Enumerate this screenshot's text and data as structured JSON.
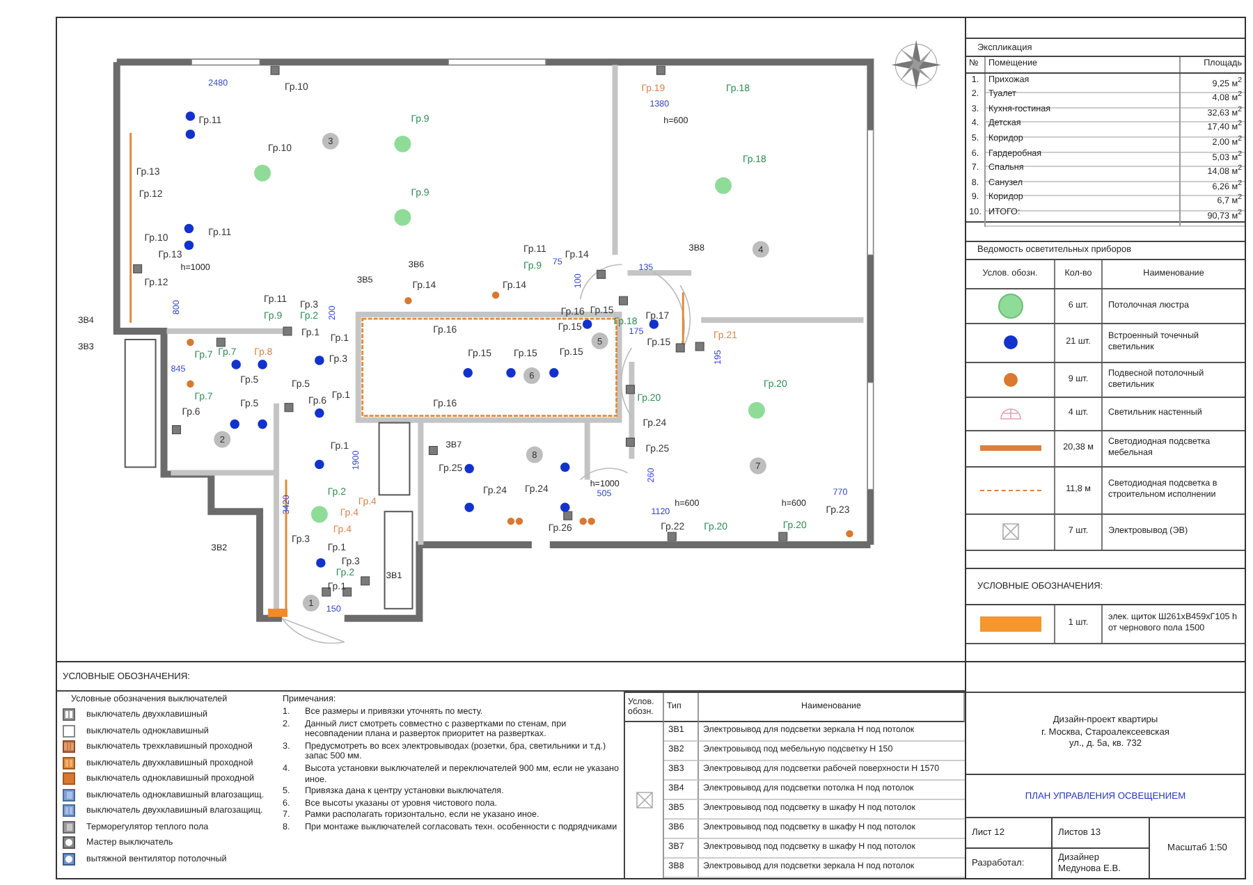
{
  "plan": {
    "labels": [
      {
        "text": "2480",
        "kind": "dimension"
      },
      {
        "text": "Гр.10",
        "kind": "group",
        "color": "#333333"
      },
      {
        "text": "Гр.11",
        "kind": "group",
        "color": "#333333"
      },
      {
        "text": "3",
        "kind": "room"
      },
      {
        "text": "Гр.10",
        "kind": "group",
        "color": "#333333"
      },
      {
        "text": "Гр.9",
        "kind": "group",
        "color": "#2f8a55"
      },
      {
        "text": "Гр.13",
        "kind": "group",
        "color": "#333333"
      },
      {
        "text": "Гр.12",
        "kind": "group",
        "color": "#333333"
      },
      {
        "text": "Гр.9",
        "kind": "group",
        "color": "#2f8a55"
      },
      {
        "text": "Гр.11",
        "kind": "group",
        "color": "#333333"
      },
      {
        "text": "Гр.10",
        "kind": "group",
        "color": "#333333"
      },
      {
        "text": "Гр.13",
        "kind": "group",
        "color": "#333333"
      },
      {
        "text": "h=1000",
        "kind": "note"
      },
      {
        "text": "Гр.12",
        "kind": "group",
        "color": "#333333"
      },
      {
        "text": "800",
        "kind": "dimension"
      },
      {
        "text": "ЗВ4",
        "kind": "outlet"
      },
      {
        "text": "ЗВ3",
        "kind": "outlet"
      },
      {
        "text": "ЗВ5",
        "kind": "outlet"
      },
      {
        "text": "ЗВ6",
        "kind": "outlet"
      },
      {
        "text": "Гр.14",
        "kind": "group",
        "color": "#333333"
      },
      {
        "text": "Гр.11",
        "kind": "group",
        "color": "#333333"
      },
      {
        "text": "Гр.9",
        "kind": "group",
        "color": "#2f8a55"
      },
      {
        "text": "Гр.3",
        "kind": "group",
        "color": "#333333"
      },
      {
        "text": "Гр.2",
        "kind": "group",
        "color": "#2f8a55"
      },
      {
        "text": "Гр.1",
        "kind": "group",
        "color": "#333333"
      },
      {
        "text": "Гр.1",
        "kind": "group",
        "color": "#333333"
      },
      {
        "text": "200",
        "kind": "dimension"
      },
      {
        "text": "Гр.7",
        "kind": "group",
        "color": "#2f8a55"
      },
      {
        "text": "Гр.7",
        "kind": "group",
        "color": "#2f8a55"
      },
      {
        "text": "Гр.8",
        "kind": "group",
        "color": "#d9824a"
      },
      {
        "text": "Гр.3",
        "kind": "group",
        "color": "#333333"
      },
      {
        "text": "845",
        "kind": "dimension"
      },
      {
        "text": "Гр.5",
        "kind": "group",
        "color": "#333333"
      },
      {
        "text": "Гр.5",
        "kind": "group",
        "color": "#333333"
      },
      {
        "text": "Гр.7",
        "kind": "group",
        "color": "#2f8a55"
      },
      {
        "text": "Гр.5",
        "kind": "group",
        "color": "#333333"
      },
      {
        "text": "Гр.6",
        "kind": "group",
        "color": "#333333"
      },
      {
        "text": "Гр.1",
        "kind": "group",
        "color": "#333333"
      },
      {
        "text": "Гр.6",
        "kind": "group",
        "color": "#333333"
      },
      {
        "text": "2",
        "kind": "room"
      },
      {
        "text": "Гр.14",
        "kind": "group",
        "color": "#333333"
      },
      {
        "text": "Гр.16",
        "kind": "group",
        "color": "#333333"
      },
      {
        "text": "Гр.15",
        "kind": "group",
        "color": "#333333"
      },
      {
        "text": "Гр.15",
        "kind": "group",
        "color": "#333333"
      },
      {
        "text": "Гр.15",
        "kind": "group",
        "color": "#333333"
      },
      {
        "text": "6",
        "kind": "room"
      },
      {
        "text": "Гр.16",
        "kind": "group",
        "color": "#333333"
      },
      {
        "text": "ЗВ7",
        "kind": "outlet"
      },
      {
        "text": "Гр.25",
        "kind": "group",
        "color": "#333333"
      },
      {
        "text": "Гр.24",
        "kind": "group",
        "color": "#333333"
      },
      {
        "text": "Гр.1",
        "kind": "group",
        "color": "#333333"
      },
      {
        "text": "1900",
        "kind": "dimension"
      },
      {
        "text": "Гр.2",
        "kind": "group",
        "color": "#2f8a55"
      },
      {
        "text": "Гр.4",
        "kind": "group",
        "color": "#d9824a"
      },
      {
        "text": "Гр.4",
        "kind": "group",
        "color": "#d9824a"
      },
      {
        "text": "Гр.4",
        "kind": "group",
        "color": "#d9824a"
      },
      {
        "text": "3420",
        "kind": "dimension"
      },
      {
        "text": "Гр.3",
        "kind": "group",
        "color": "#333333"
      },
      {
        "text": "ЗВ2",
        "kind": "outlet"
      },
      {
        "text": "Гр.1",
        "kind": "group",
        "color": "#333333"
      },
      {
        "text": "Гр.3",
        "kind": "group",
        "color": "#333333"
      },
      {
        "text": "Гр.2",
        "kind": "group",
        "color": "#2f8a55"
      },
      {
        "text": "Гр.1",
        "kind": "group",
        "color": "#333333"
      },
      {
        "text": "ЗВ1",
        "kind": "outlet"
      },
      {
        "text": "1",
        "kind": "room"
      },
      {
        "text": "150",
        "kind": "dimension"
      },
      {
        "text": "Гр.19",
        "kind": "group",
        "color": "#d9824a"
      },
      {
        "text": "Гр.18",
        "kind": "group",
        "color": "#2f8a55"
      },
      {
        "text": "1380",
        "kind": "dimension"
      },
      {
        "text": "h=600",
        "kind": "note"
      },
      {
        "text": "Гр.18",
        "kind": "group",
        "color": "#2f8a55"
      },
      {
        "text": "Гр.11",
        "kind": "group",
        "color": "#333333"
      },
      {
        "text": "Гр.14",
        "kind": "group",
        "color": "#333333"
      },
      {
        "text": "ЗВ8",
        "kind": "outlet"
      },
      {
        "text": "4",
        "kind": "room"
      },
      {
        "text": "Гр.9",
        "kind": "group",
        "color": "#2f8a55"
      },
      {
        "text": "75",
        "kind": "dimension"
      },
      {
        "text": "135",
        "kind": "dimension"
      },
      {
        "text": "100",
        "kind": "dimension"
      },
      {
        "text": "Гр.16",
        "kind": "group",
        "color": "#333333"
      },
      {
        "text": "Гр.15",
        "kind": "group",
        "color": "#333333"
      },
      {
        "text": "Гр.15",
        "kind": "group",
        "color": "#333333"
      },
      {
        "text": "Гр.18",
        "kind": "group",
        "color": "#2f8a55"
      },
      {
        "text": "Гр.17",
        "kind": "group",
        "color": "#333333"
      },
      {
        "text": "175",
        "kind": "dimension"
      },
      {
        "text": "5",
        "kind": "room"
      },
      {
        "text": "Гр.15",
        "kind": "group",
        "color": "#333333"
      },
      {
        "text": "Гр.21",
        "kind": "group",
        "color": "#d9824a"
      },
      {
        "text": "195",
        "kind": "dimension"
      },
      {
        "text": "Гр.20",
        "kind": "group",
        "color": "#2f8a55"
      },
      {
        "text": "Гр.20",
        "kind": "group",
        "color": "#2f8a55"
      },
      {
        "text": "Гр.24",
        "kind": "group",
        "color": "#333333"
      },
      {
        "text": "8",
        "kind": "room"
      },
      {
        "text": "Гр.25",
        "kind": "group",
        "color": "#333333"
      },
      {
        "text": "7",
        "kind": "room"
      },
      {
        "text": "Гр.24",
        "kind": "group",
        "color": "#333333"
      },
      {
        "text": "h=1000",
        "kind": "note"
      },
      {
        "text": "505",
        "kind": "dimension"
      },
      {
        "text": "260",
        "kind": "dimension"
      },
      {
        "text": "770",
        "kind": "dimension"
      },
      {
        "text": "1120",
        "kind": "dimension"
      },
      {
        "text": "h=600",
        "kind": "note"
      },
      {
        "text": "h=600",
        "kind": "note"
      },
      {
        "text": "Гр.23",
        "kind": "group",
        "color": "#333333"
      },
      {
        "text": "Гр.26",
        "kind": "group",
        "color": "#333333"
      },
      {
        "text": "Гр.22",
        "kind": "group",
        "color": "#333333"
      },
      {
        "text": "Гр.20",
        "kind": "group",
        "color": "#2f8a55"
      },
      {
        "text": "Гр.20",
        "kind": "group",
        "color": "#2f8a55"
      }
    ]
  },
  "explication": {
    "title": "Экспликация",
    "columns": [
      "№",
      "Помещение",
      "Площадь"
    ],
    "rows": [
      {
        "number": "1.",
        "name": "Прихожая",
        "area": "9,25 м$^{2}$"
      },
      {
        "number": "2.",
        "name": "Туалет",
        "area": "4,08 м$^{2}$"
      },
      {
        "number": "3.",
        "name": "Кухня-гостиная",
        "area": "32,63 м$^{2}$"
      },
      {
        "number": "4.",
        "name": "Детская",
        "area": "17,40 м$^{2}$"
      },
      {
        "number": "5.",
        "name": "Коридор",
        "area": "2,00 м$^{2}$"
      },
      {
        "number": "6.",
        "name": "Гардеробная",
        "area": "5,03 м$^{2}$"
      },
      {
        "number": "7.",
        "name": "Спальня",
        "area": "14,08 м$^{2}$"
      },
      {
        "number": "8.",
        "name": "Санузел",
        "area": "6,26 м$^{2}$"
      },
      {
        "number": "9.",
        "name": "Коридор",
        "area": "6,7 м$^{2}$"
      },
      {
        "number": "10.",
        "name": "ИТОГО:",
        "area": "90,73 м$^{2}$"
      }
    ]
  },
  "fixtures": {
    "title": "Ведомость осветительных приборов",
    "columns": [
      "Услов. обозн.",
      "Кол-во",
      "Наименование"
    ],
    "rows": [
      {
        "kind": "chandelier",
        "qty": "6 шт.",
        "name": "Потолочная люстра"
      },
      {
        "kind": "spot",
        "qty": "21 шт.",
        "name": "Встроенный точечный светильник"
      },
      {
        "kind": "pendant",
        "qty": "9 шт.",
        "name": "Подвесной потолочный светильник"
      },
      {
        "kind": "wall_lamp",
        "qty": "4 шт.",
        "name": "Светильник настенный"
      },
      {
        "kind": "led_furniture",
        "qty": "20,38 м",
        "name": "Светодиодная подсветка мебельная"
      },
      {
        "kind": "led_builtin",
        "qty": "11,8 м",
        "name": "Светодиодная подсветка в строительном исполнении"
      },
      {
        "kind": "outlet",
        "qty": "7 шт.",
        "name": "Электровывод (ЭВ)"
      }
    ]
  },
  "symbols": {
    "title": "УСЛОВНЫЕ ОБОЗНАЧЕНИЯ:",
    "rows": [
      {
        "kind": "panel",
        "qty": "1 шт.",
        "name": "элек. щиток Ш261хВ459хГ105 h от чернового пола 1500"
      }
    ]
  },
  "legend": {
    "title": "УСЛОВНЫЕ ОБОЗНАЧЕНИЯ:",
    "switches_title": "Условные обозначения выключателей",
    "switches": [
      {
        "kind": "double",
        "label": "выключатель двухклавишный"
      },
      {
        "kind": "single",
        "label": "выключатель одноклавишный"
      },
      {
        "kind": "triple_pass",
        "label": "выключатель трехклавишный проходной"
      },
      {
        "kind": "double_pass",
        "label": "выключатель двухклавишный проходной"
      },
      {
        "kind": "single_pass",
        "label": "выключатель одноклавишный проходной"
      },
      {
        "kind": "single_wet",
        "label": "выключатель одноклавишный влагозащищ."
      },
      {
        "kind": "double_wet",
        "label": "выключатель двухклавишный влагозащищ."
      },
      {
        "kind": "thermostat",
        "label": "Терморегулятор теплого пола"
      },
      {
        "kind": "master",
        "label": "Мастер выключатель"
      },
      {
        "kind": "fan",
        "label": "вытяжной вентилятор потолочный"
      }
    ],
    "notes_title": "Примечания:",
    "notes": [
      {
        "number": "1.",
        "text": "Все размеры и привязки уточнять по месту."
      },
      {
        "number": "2.",
        "text": "Данный лист смотреть совместно с развертками по стенам, при несовпадении плана и разверток приоритет на развертках."
      },
      {
        "number": "3.",
        "text": "Предусмотреть во всех электровыводах (розетки, бра, светильники и т.д.) запас 500 мм."
      },
      {
        "number": "4.",
        "text": "Высота установки выключателей и переключателей 900 мм, если не указано иное."
      },
      {
        "number": "5.",
        "text": "Привязка дана к центру установки выключателя."
      },
      {
        "number": "6.",
        "text": "Все высоты указаны от уровня чистового пола."
      },
      {
        "number": "7.",
        "text": "Рамки располагать горизонтально, если не указано иное."
      },
      {
        "number": "8.",
        "text": "При монтаже выключателей согласовать техн. особенности с подрядчиками"
      }
    ]
  },
  "outlets": {
    "columns": [
      "Услов. обозн.",
      "Тип",
      "Наименование"
    ],
    "rows": [
      {
        "type": "ЗВ1",
        "name": "Электровывод для подсветки зеркала Н под потолок"
      },
      {
        "type": "ЗВ2",
        "name": "Электровывод под мебельную подсветку Н 150"
      },
      {
        "type": "ЗВ3",
        "name": "Электровывод для подсветки рабочей поверхности Н 1570"
      },
      {
        "type": "ЗВ4",
        "name": "Электровывод для подсветки потолка Н под потолок"
      },
      {
        "type": "ЗВ5",
        "name": "Электровывод под подсветку в шкафу Н под потолок"
      },
      {
        "type": "ЗВ6",
        "name": "Электровывод под подсветку в шкафу Н под потолок"
      },
      {
        "type": "ЗВ7",
        "name": "Электровывод под подсветку в шкафу Н под потолок"
      },
      {
        "type": "ЗВ8",
        "name": "Электровывод для подсветки зеркала Н под потолок"
      }
    ]
  },
  "title_block": {
    "address_lines": [
      "Дизайн-проект квартиры",
      "г. Москва, Староалексеевская",
      "ул., д. 5а, кв. 732"
    ],
    "title": "ПЛАН УПРАВЛЕНИЯ ОСВЕЩЕНИЕМ",
    "sheet": "Лист 12",
    "sheets": "Листов 13",
    "scale": "Масштаб 1:50",
    "author_label": "Разработал:",
    "author": "Дизайнер Медунова Е.В."
  }
}
